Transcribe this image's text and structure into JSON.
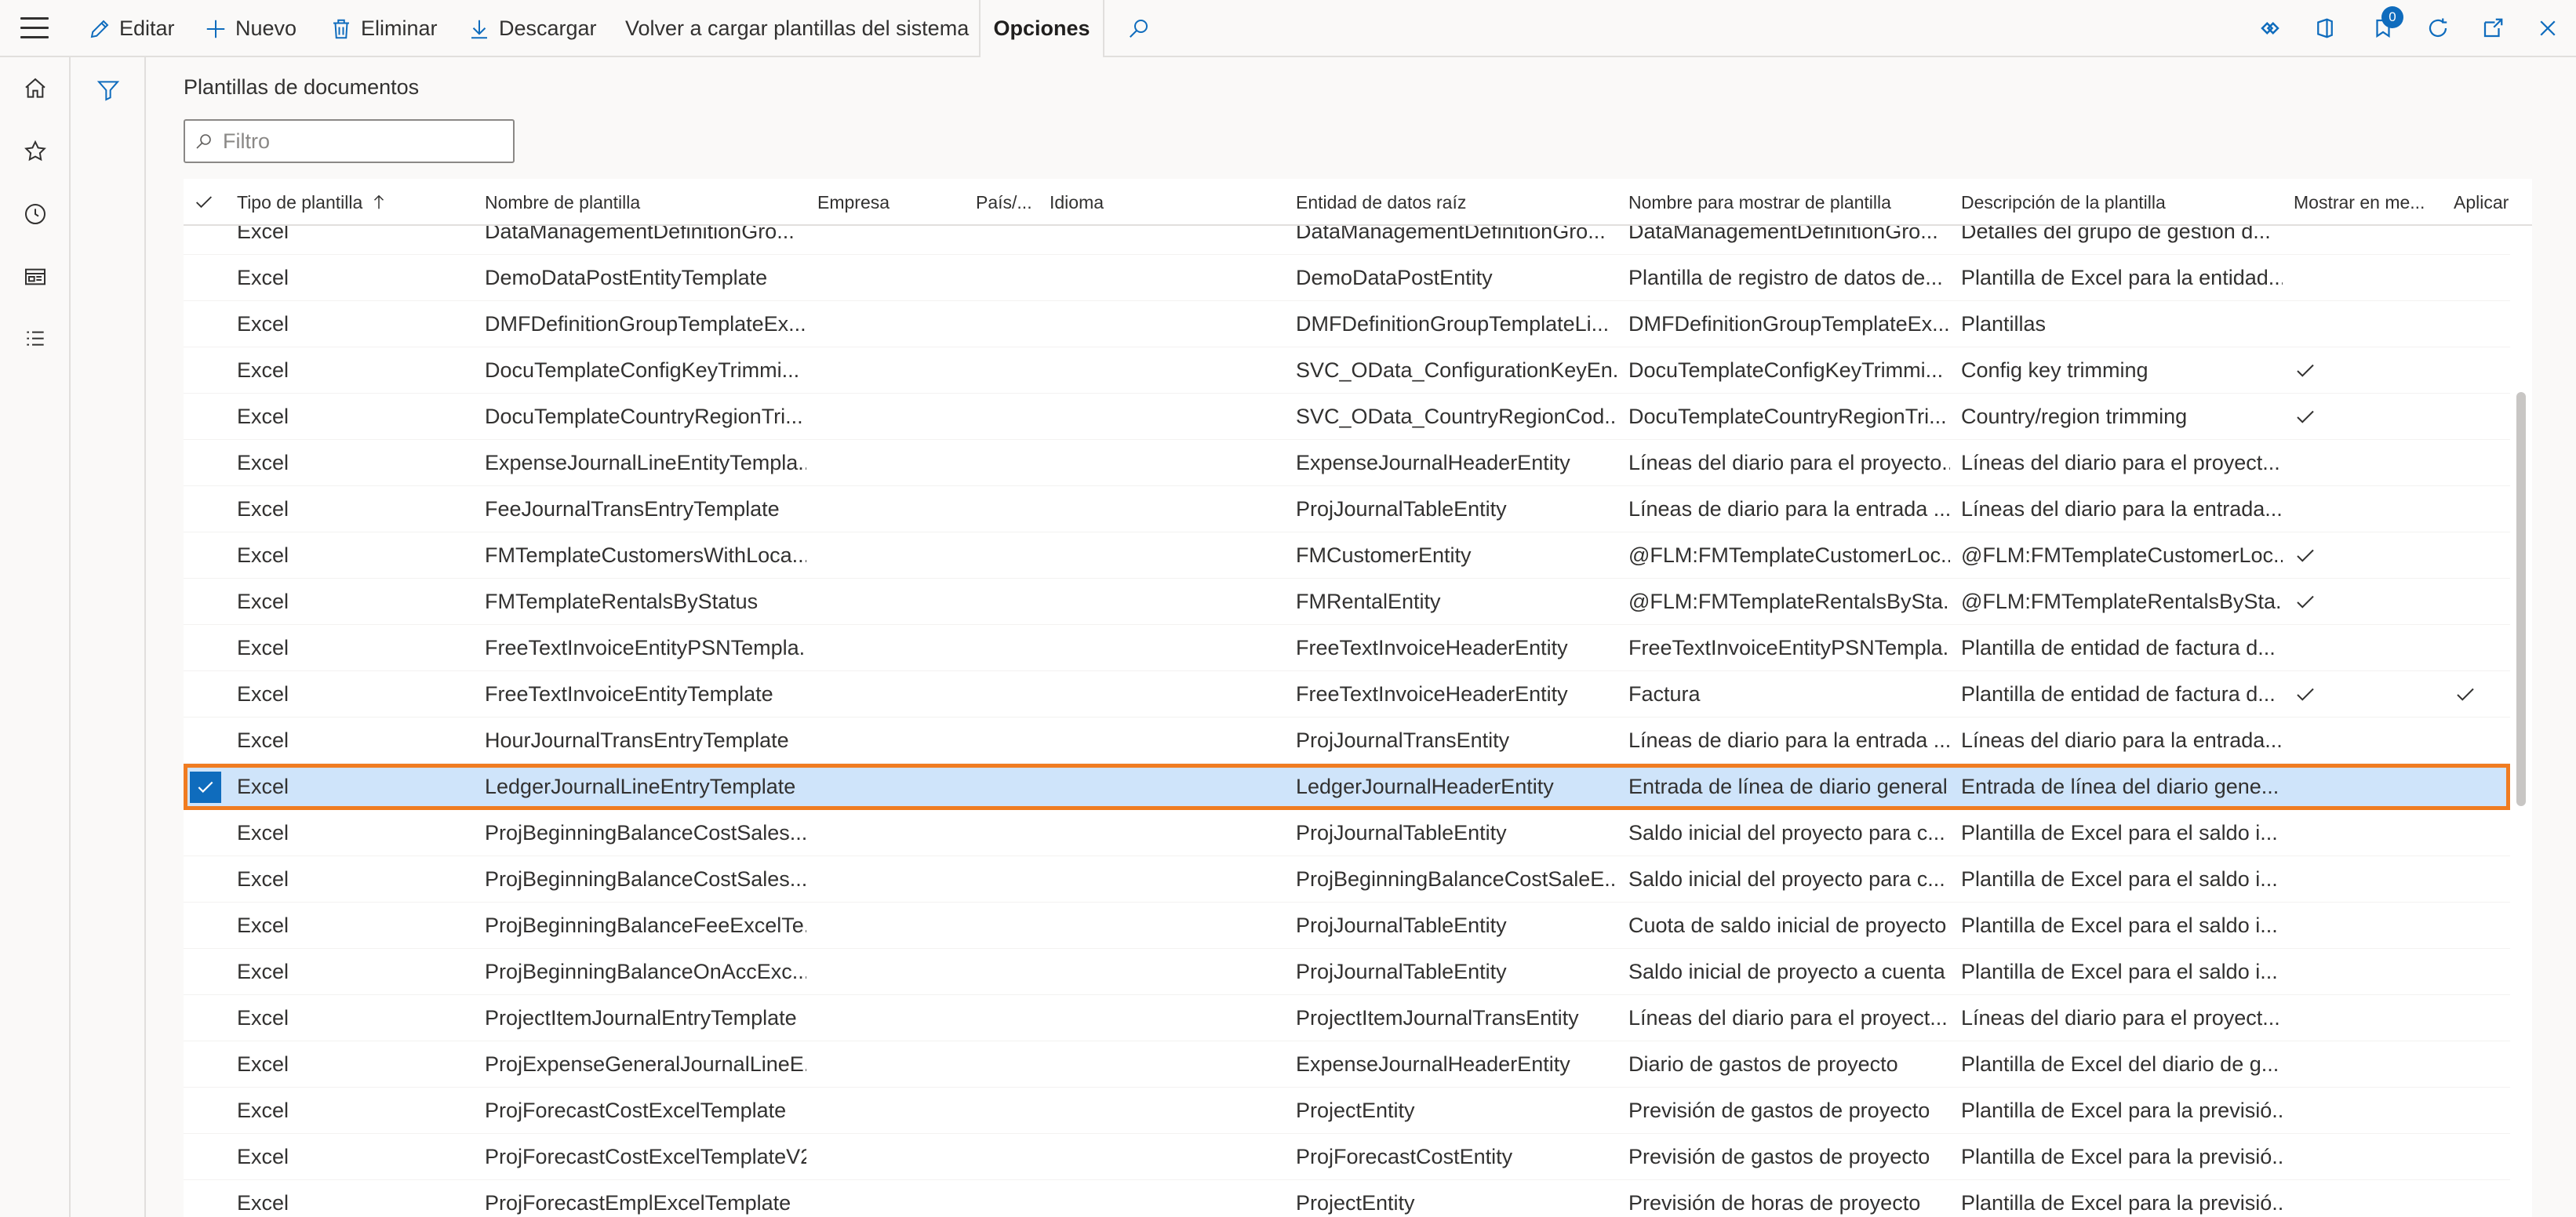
{
  "toolbar": {
    "edit_label": "Editar",
    "new_label": "Nuevo",
    "delete_label": "Eliminar",
    "download_label": "Descargar",
    "reload_label": "Volver a cargar plantillas del sistema",
    "options_label": "Opciones",
    "notification_count": "0"
  },
  "page": {
    "title": "Plantillas de documentos",
    "filter_placeholder": "Filtro"
  },
  "grid": {
    "columns": {
      "type": "Tipo de plantilla",
      "name": "Nombre de plantilla",
      "company": "Empresa",
      "country": "País/...",
      "language": "Idioma",
      "root": "Entidad de datos raíz",
      "display": "Nombre para mostrar de plantilla",
      "description": "Descripción de la plantilla",
      "show": "Mostrar en me...",
      "apply": "Aplicar"
    },
    "rows": [
      {
        "type": "Excel",
        "name": "DataManagementDefinitionGro...",
        "root": "DataManagementDefinitionGro...",
        "display": "DataManagementDefinitionGro...",
        "description": "Detalles del grupo de gestión d...",
        "show": false,
        "apply": false,
        "selected": false
      },
      {
        "type": "Excel",
        "name": "DemoDataPostEntityTemplate",
        "root": "DemoDataPostEntity",
        "display": "Plantilla de registro de datos de...",
        "description": "Plantilla de Excel para la entidad...",
        "show": false,
        "apply": false,
        "selected": false
      },
      {
        "type": "Excel",
        "name": "DMFDefinitionGroupTemplateEx...",
        "root": "DMFDefinitionGroupTemplateLi...",
        "display": "DMFDefinitionGroupTemplateEx...",
        "description": "Plantillas",
        "show": false,
        "apply": false,
        "selected": false
      },
      {
        "type": "Excel",
        "name": "DocuTemplateConfigKeyTrimmi...",
        "root": "SVC_OData_ConfigurationKeyEn...",
        "display": "DocuTemplateConfigKeyTrimmi...",
        "description": "Config key trimming",
        "show": true,
        "apply": false,
        "selected": false
      },
      {
        "type": "Excel",
        "name": "DocuTemplateCountryRegionTri...",
        "root": "SVC_OData_CountryRegionCod...",
        "display": "DocuTemplateCountryRegionTri...",
        "description": "Country/region trimming",
        "show": true,
        "apply": false,
        "selected": false
      },
      {
        "type": "Excel",
        "name": "ExpenseJournalLineEntityTempla...",
        "root": "ExpenseJournalHeaderEntity",
        "display": "Líneas del diario para el proyecto...",
        "description": "Líneas del diario para el proyect...",
        "show": false,
        "apply": false,
        "selected": false
      },
      {
        "type": "Excel",
        "name": "FeeJournalTransEntryTemplate",
        "root": "ProjJournalTableEntity",
        "display": "Líneas de diario para la entrada ...",
        "description": "Líneas del diario para la entrada...",
        "show": false,
        "apply": false,
        "selected": false
      },
      {
        "type": "Excel",
        "name": "FMTemplateCustomersWithLoca...",
        "root": "FMCustomerEntity",
        "display": "@FLM:FMTemplateCustomerLoc...",
        "description": "@FLM:FMTemplateCustomerLoc...",
        "show": true,
        "apply": false,
        "selected": false
      },
      {
        "type": "Excel",
        "name": "FMTemplateRentalsByStatus",
        "root": "FMRentalEntity",
        "display": "@FLM:FMTemplateRentalsBySta...",
        "description": "@FLM:FMTemplateRentalsBySta...",
        "show": true,
        "apply": false,
        "selected": false
      },
      {
        "type": "Excel",
        "name": "FreeTextInvoiceEntityPSNTempla...",
        "root": "FreeTextInvoiceHeaderEntity",
        "display": "FreeTextInvoiceEntityPSNTempla...",
        "description": "Plantilla de entidad de factura d...",
        "show": false,
        "apply": false,
        "selected": false
      },
      {
        "type": "Excel",
        "name": "FreeTextInvoiceEntityTemplate",
        "root": "FreeTextInvoiceHeaderEntity",
        "display": "Factura",
        "description": "Plantilla de entidad de factura d...",
        "show": true,
        "apply": true,
        "selected": false
      },
      {
        "type": "Excel",
        "name": "HourJournalTransEntryTemplate",
        "root": "ProjJournalTransEntity",
        "display": "Líneas de diario para la entrada ...",
        "description": "Líneas del diario para la entrada...",
        "show": false,
        "apply": false,
        "selected": false
      },
      {
        "type": "Excel",
        "name": "LedgerJournalLineEntryTemplate",
        "root": "LedgerJournalHeaderEntity",
        "display": "Entrada de línea de diario general",
        "description": "Entrada de línea del diario gene...",
        "show": false,
        "apply": false,
        "selected": true
      },
      {
        "type": "Excel",
        "name": "ProjBeginningBalanceCostSales...",
        "root": "ProjJournalTableEntity",
        "display": "Saldo inicial del proyecto para c...",
        "description": "Plantilla de Excel para el saldo i...",
        "show": false,
        "apply": false,
        "selected": false
      },
      {
        "type": "Excel",
        "name": "ProjBeginningBalanceCostSales...",
        "root": "ProjBeginningBalanceCostSaleE...",
        "display": "Saldo inicial del proyecto para c...",
        "description": "Plantilla de Excel para el saldo i...",
        "show": false,
        "apply": false,
        "selected": false
      },
      {
        "type": "Excel",
        "name": "ProjBeginningBalanceFeeExcelTe...",
        "root": "ProjJournalTableEntity",
        "display": "Cuota de saldo inicial de proyecto",
        "description": "Plantilla de Excel para el saldo i...",
        "show": false,
        "apply": false,
        "selected": false
      },
      {
        "type": "Excel",
        "name": "ProjBeginningBalanceOnAccExc...",
        "root": "ProjJournalTableEntity",
        "display": "Saldo inicial de proyecto a cuenta",
        "description": "Plantilla de Excel para el saldo i...",
        "show": false,
        "apply": false,
        "selected": false
      },
      {
        "type": "Excel",
        "name": "ProjectItemJournalEntryTemplate",
        "root": "ProjectItemJournalTransEntity",
        "display": "Líneas del diario para el proyect...",
        "description": "Líneas del diario para el proyect...",
        "show": false,
        "apply": false,
        "selected": false
      },
      {
        "type": "Excel",
        "name": "ProjExpenseGeneralJournalLineE...",
        "root": "ExpenseJournalHeaderEntity",
        "display": "Diario de gastos de proyecto",
        "description": "Plantilla de Excel del diario de g...",
        "show": false,
        "apply": false,
        "selected": false
      },
      {
        "type": "Excel",
        "name": "ProjForecastCostExcelTemplate",
        "root": "ProjectEntity",
        "display": "Previsión de gastos de proyecto",
        "description": "Plantilla de Excel para la previsió...",
        "show": false,
        "apply": false,
        "selected": false
      },
      {
        "type": "Excel",
        "name": "ProjForecastCostExcelTemplateV2",
        "root": "ProjForecastCostEntity",
        "display": "Previsión de gastos de proyecto",
        "description": "Plantilla de Excel para la previsió...",
        "show": false,
        "apply": false,
        "selected": false
      },
      {
        "type": "Excel",
        "name": "ProjForecastEmplExcelTemplate",
        "root": "ProjectEntity",
        "display": "Previsión de horas de proyecto",
        "description": "Plantilla de Excel para la previsió...",
        "show": false,
        "apply": false,
        "selected": false
      }
    ]
  },
  "colors": {
    "accent": "#0f6cbd",
    "selected_row": "#cfe4fa",
    "focus_outline": "#f07c21"
  }
}
